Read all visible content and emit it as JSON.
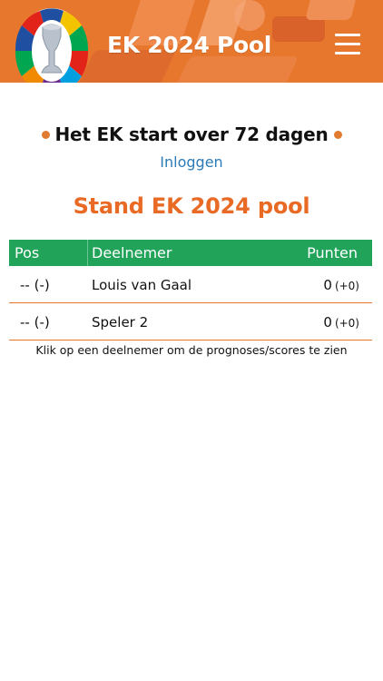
{
  "header": {
    "title": "EK 2024 Pool",
    "logo_icon": "euro-2024-trophy-logo",
    "menu_icon": "hamburger-menu-icon",
    "brand_color": "#e8772e"
  },
  "countdown": {
    "text": "Het EK start over 72 dagen"
  },
  "login": {
    "label": "Inloggen",
    "color": "#2a7bb8"
  },
  "standings": {
    "title": "Stand EK 2024 pool",
    "title_color": "#e86a24",
    "header_color": "#21a35a",
    "columns": {
      "pos": "Pos",
      "name": "Deelnemer",
      "points": "Punten"
    },
    "rows": [
      {
        "pos": "-- (-)",
        "name": "Louis van Gaal",
        "points": "0",
        "delta": "(+0)"
      },
      {
        "pos": "-- (-)",
        "name": "Speler 2",
        "points": "0",
        "delta": "(+0)"
      }
    ],
    "hint": "Klik op een deelnemer om de prognoses/scores te zien"
  }
}
